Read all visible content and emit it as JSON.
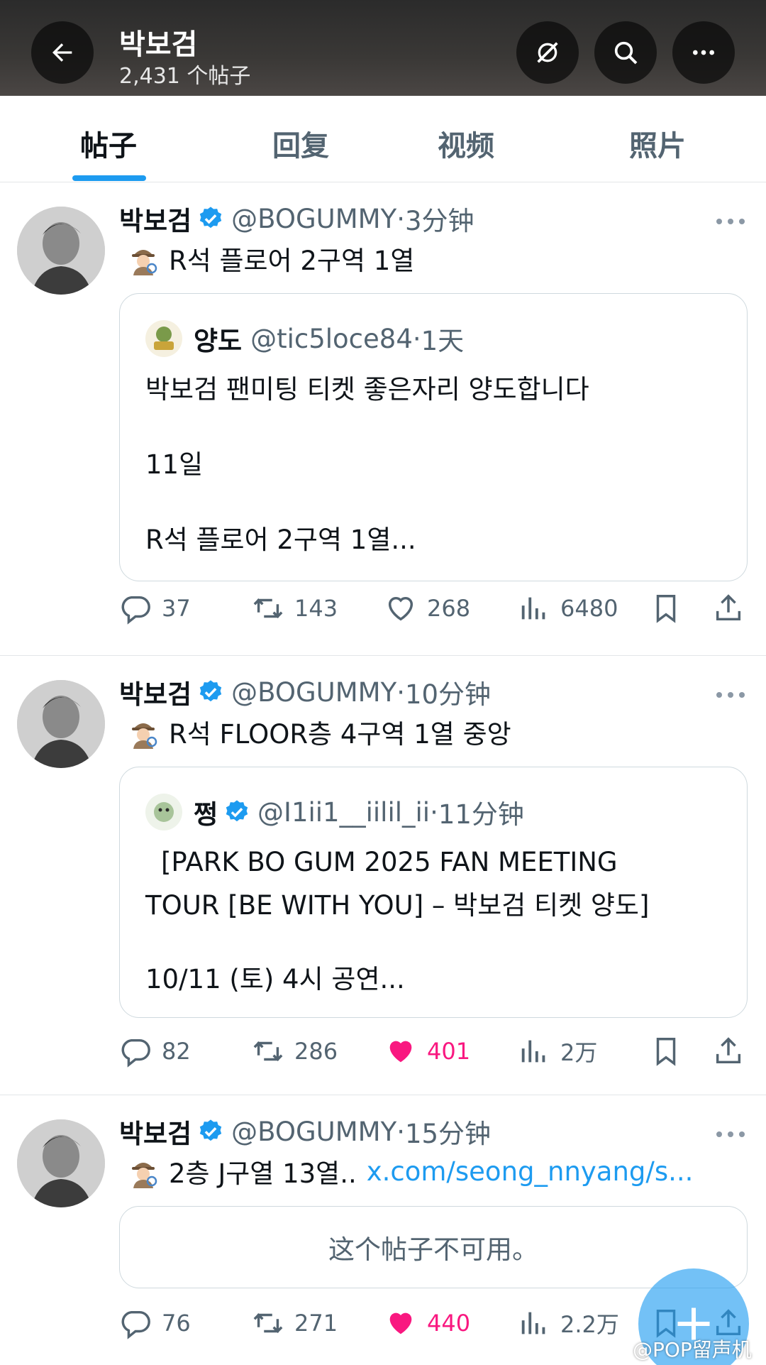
{
  "header": {
    "title": "박보검",
    "subtitle": "2,431 个帖子",
    "back_icon": "back-arrow-icon",
    "right_icons": [
      "grok-icon",
      "search-icon",
      "more-icon"
    ]
  },
  "tabs": [
    {
      "label": "帖子",
      "active": true
    },
    {
      "label": "回复",
      "active": false
    },
    {
      "label": "视频",
      "active": false
    },
    {
      "label": "照片",
      "active": false
    }
  ],
  "posts": [
    {
      "name": "박보검",
      "handle": "@BOGUMMY",
      "dot": "·",
      "time": "3分钟",
      "text": "R석 플로어 2구역 1열",
      "quote": {
        "name": "양도",
        "handle": "@tic5loce84",
        "dot": "·",
        "time": "1天",
        "lines": [
          "박보검 팬미팅 티켓 좋은자리 양도합니다",
          "11일",
          "R석 플로어 2구역 1열..."
        ]
      },
      "stats": {
        "replies": "37",
        "reposts": "143",
        "likes": "268",
        "views": "6480"
      },
      "liked": false
    },
    {
      "name": "박보검",
      "handle": "@BOGUMMY",
      "dot": "·",
      "time": "10分钟",
      "text": "R석 FLOOR층 4구역 1열 중앙",
      "quote": {
        "name": "쩡",
        "handle": "@I1ii1__iilil_ii",
        "dot": "·",
        "time": "11分钟",
        "lines": [
          "[PARK BO GUM 2025 FAN MEETING",
          "TOUR [BE WITH YOU] – 박보검 티켓 양도]",
          "10/11 (토) 4시 공연..."
        ]
      },
      "stats": {
        "replies": "82",
        "reposts": "286",
        "likes": "401",
        "views": "2万"
      },
      "liked": true
    },
    {
      "name": "박보검",
      "handle": "@BOGUMMY",
      "dot": "·",
      "time": "15分钟",
      "text": "2층 J구열 13열..",
      "link": "x.com/seong_nnyang/s...",
      "unavailable": "这个帖子不可用。",
      "stats": {
        "replies": "76",
        "reposts": "271",
        "likes": "440",
        "views": "2.2万"
      },
      "liked": true
    }
  ],
  "watermark": "@POP留声机",
  "colors": {
    "accent": "#1d9bf0",
    "like": "#f91880",
    "muted": "#536471"
  }
}
